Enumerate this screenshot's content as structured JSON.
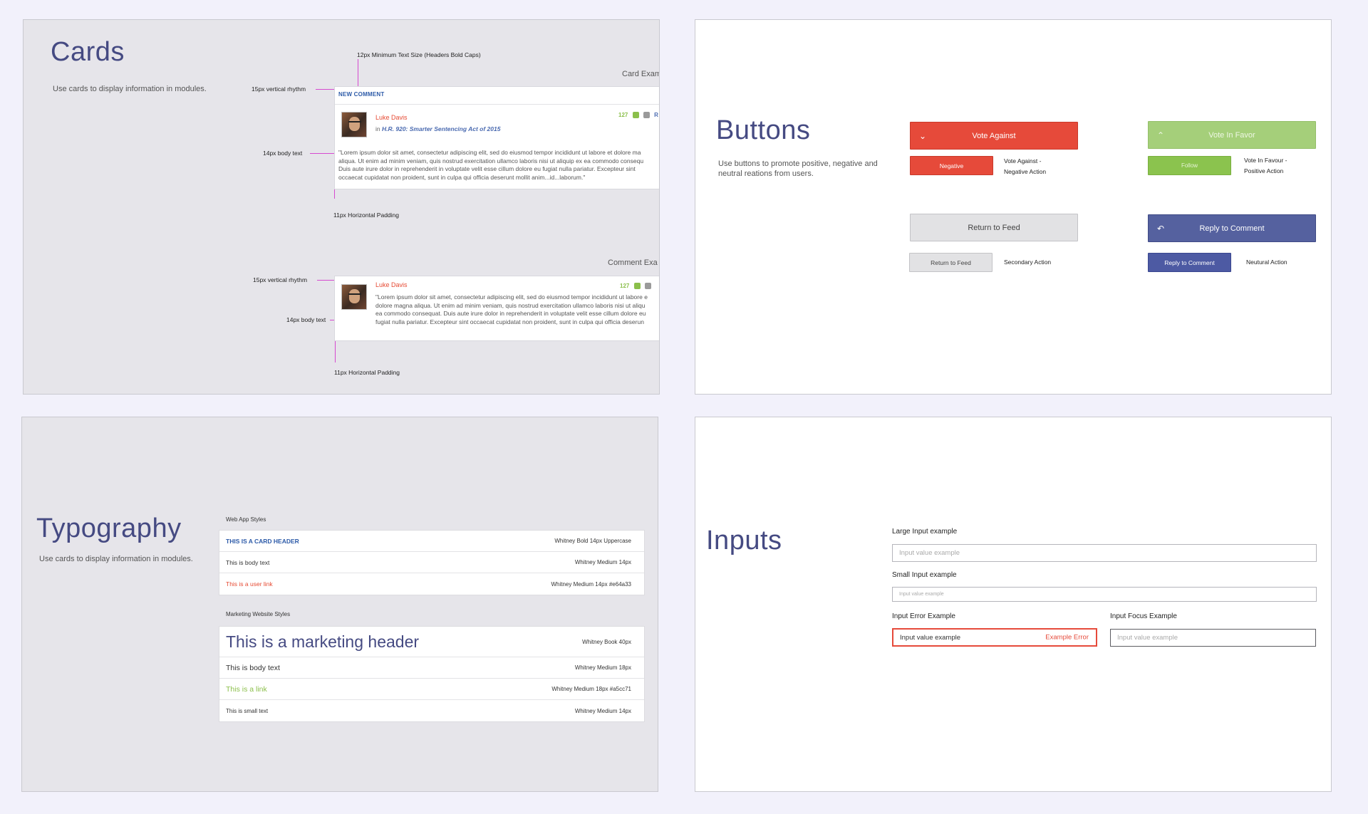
{
  "cards": {
    "title": "Cards",
    "description": "Use cards to display information in modules.",
    "ann_min_text": "12px Minimum Text Size (Headers Bold Caps)",
    "ann_rhythm_1": "15px vertical rhythm",
    "ann_body_1": "14px body text",
    "ann_padding_1": "11px Horizontal Padding",
    "ann_rhythm_2": "15px vertical rhythm",
    "ann_body_2": "14px body text",
    "ann_padding_2": "11px Horizontal Padding",
    "card_example_label": "Card Exam",
    "comment_example_label": "Comment Exa",
    "card": {
      "header": "NEW COMMENT",
      "user": "Luke Davis",
      "in_word": "in",
      "bill": "H.R. 920: Smarter Sentencing Act of 2015",
      "votes": "127",
      "reply_cut": "R",
      "body_lines": [
        "\"Lorem ipsum dolor sit amet, consectetur adipiscing elit, sed do eiusmod tempor incididunt ut labore et dolore ma",
        "aliqua. Ut enim ad minim veniam, quis nostrud exercitation ullamco laboris nisi ut aliquip ex ea commodo consequ",
        "Duis aute irure dolor in reprehenderit in voluptate velit esse cillum dolore eu fugiat nulla pariatur. Excepteur sint",
        "occaecat cupidatat non proident, sunt in culpa qui officia deserunt mollit anim...id...laborum.\""
      ]
    },
    "comment": {
      "user": "Luke Davis",
      "votes": "127",
      "body_lines": [
        "\"Lorem ipsum dolor sit amet, consectetur adipiscing elit, sed do eiusmod tempor incididunt ut labore e",
        "dolore magna aliqua. Ut enim ad minim veniam, quis nostrud exercitation ullamco laboris nisi ut aliqu",
        "ea commodo consequat. Duis aute irure dolor in reprehenderit in voluptate velit esse cillum dolore eu",
        "fugiat nulla pariatur. Excepteur sint occaecat cupidatat non proident, sunt in culpa qui officia deserun"
      ]
    }
  },
  "buttons": {
    "title": "Buttons",
    "description": "Use buttons to promote positive, negative and neutral reations from users.",
    "vote_against": "Vote Against",
    "negative": "Negative",
    "negative_desc_1": "Vote Against -",
    "negative_desc_2": "Negative Action",
    "vote_in_favor": "Vote In Favor",
    "follow": "Follow",
    "positive_desc_1": "Vote In Favour -",
    "positive_desc_2": "Positive Action",
    "return_to_feed": "Return to Feed",
    "return_to_feed_small": "Return to Feed",
    "secondary_desc": "Secondary Action",
    "reply_to_comment": "Reply to Comment",
    "reply_to_comment_small": "Reply to Comment",
    "neutral_desc": "Neutural Action"
  },
  "typography": {
    "title": "Typography",
    "description": "Use cards to display information in modules.",
    "web_styles_label": "Web App Styles",
    "web_rows": [
      {
        "sample": "THIS IS A CARD HEADER",
        "spec": "Whitney Bold 14px Uppercase"
      },
      {
        "sample": "This is body text",
        "spec": "Whitney Medium 14px"
      },
      {
        "sample": "This is a user link",
        "spec": "Whitney Medium 14px #e64a33"
      }
    ],
    "marketing_styles_label": "Marketing Website Styles",
    "marketing_rows": [
      {
        "sample": "This is a marketing header",
        "spec": "Whitney Book 40px"
      },
      {
        "sample": "This is body text",
        "spec": "Whitney Medium 18px"
      },
      {
        "sample": "This is a link",
        "spec": "Whitney Medium 18px #a5cc71"
      },
      {
        "sample": "This is small text",
        "spec": "Whitney Medium 14px"
      }
    ]
  },
  "inputs": {
    "title": "Inputs",
    "large_label": "Large Input example",
    "large_placeholder": "Input value example",
    "small_label": "Small Input example",
    "small_placeholder": "Input value example",
    "error_label": "Input Error Example",
    "error_value": "Input value example",
    "error_message": "Example Error",
    "focus_label": "Input Focus Example",
    "focus_placeholder": "Input value example"
  },
  "colors": {
    "title": "#454a82",
    "negative": "#e64a3a",
    "positive": "#a5cf7a",
    "neutral": "#55619f",
    "user_link": "#e64a33",
    "link_green": "#a5cc71",
    "card_header": "#2c5aa8",
    "annotation": "#d64ad0"
  }
}
